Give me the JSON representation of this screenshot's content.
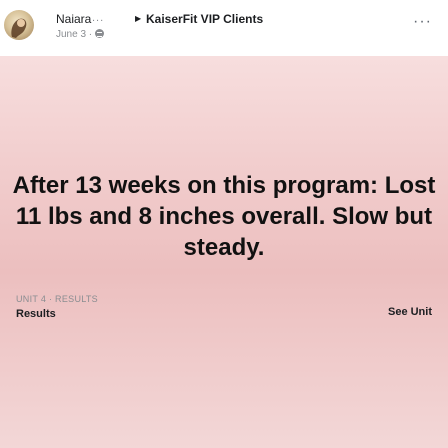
{
  "post": {
    "author": "Naiara",
    "author_ellipsis": "...",
    "group_caret": "▶",
    "group": "KaiserFit VIP Clients",
    "date": "June 3 ·",
    "message": "After 13 weeks on this program: Lost 11 lbs and 8 inches overall. Slow but steady."
  },
  "icons": {
    "avatar": "profile-photo",
    "privacy": "globe-icon",
    "more": "more-options-icon"
  },
  "unit": {
    "label": "UNIT 4 · RESULTS",
    "title": "Results",
    "cta": "See Unit"
  },
  "colors": {
    "card_background": "#f1cccc",
    "text": "#111111",
    "muted": "#8a8d91"
  }
}
